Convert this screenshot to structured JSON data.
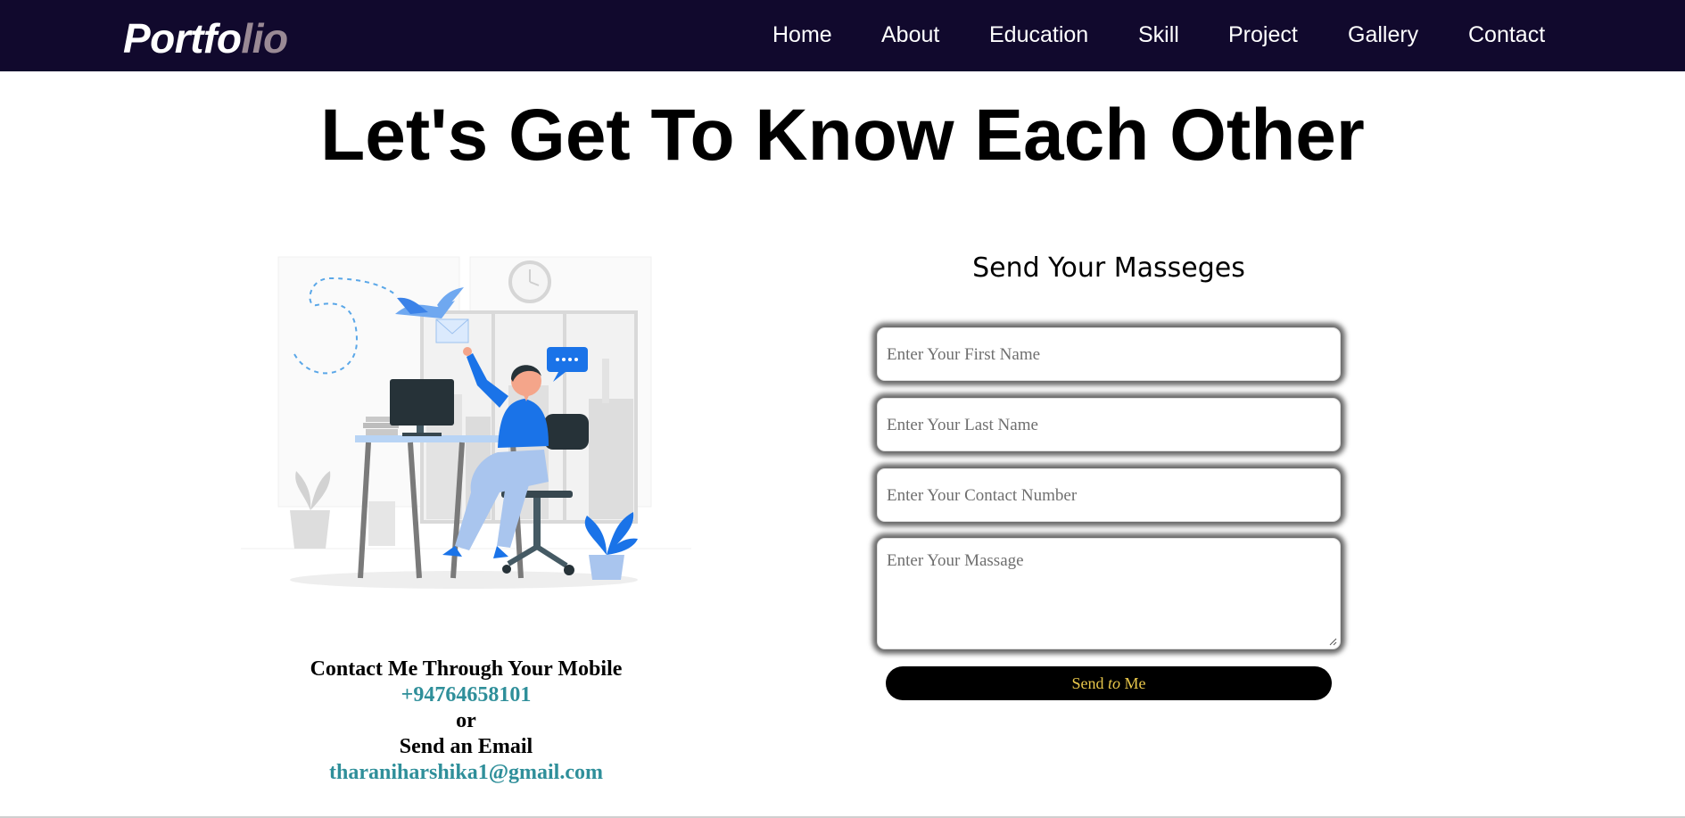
{
  "nav": {
    "logo_part1": "Portfo",
    "logo_part2": "lio",
    "links": [
      "Home",
      "About",
      "Education",
      "Skill",
      "Project",
      "Gallery",
      "Contact"
    ]
  },
  "hero": {
    "title": "Let's Get To Know Each Other"
  },
  "contact": {
    "mobile_heading": "Contact Me Through Your Mobile",
    "phone": "+94764658101",
    "or": "or",
    "email_heading": "Send an Email",
    "email": "tharaniharshika1@gmail.com"
  },
  "form": {
    "title": "Send Your Masseges",
    "first_name_placeholder": "Enter Your First Name",
    "last_name_placeholder": "Enter Your Last Name",
    "contact_placeholder": "Enter Your Contact Number",
    "message_placeholder": "Enter Your Massage",
    "send_prefix": "Send ",
    "send_italic": "to",
    "send_suffix": " Me"
  },
  "colors": {
    "navbar": "#11092d",
    "logo_secondary": "#9a8a95",
    "link_teal": "#2f8f9a",
    "button_text": "#e8c64a",
    "accent_blue": "#1a73e8"
  },
  "icons": [
    "clock-icon",
    "bird-icon",
    "envelope-icon",
    "chat-bubble-icon",
    "computer-monitor-icon",
    "plant-icon"
  ]
}
